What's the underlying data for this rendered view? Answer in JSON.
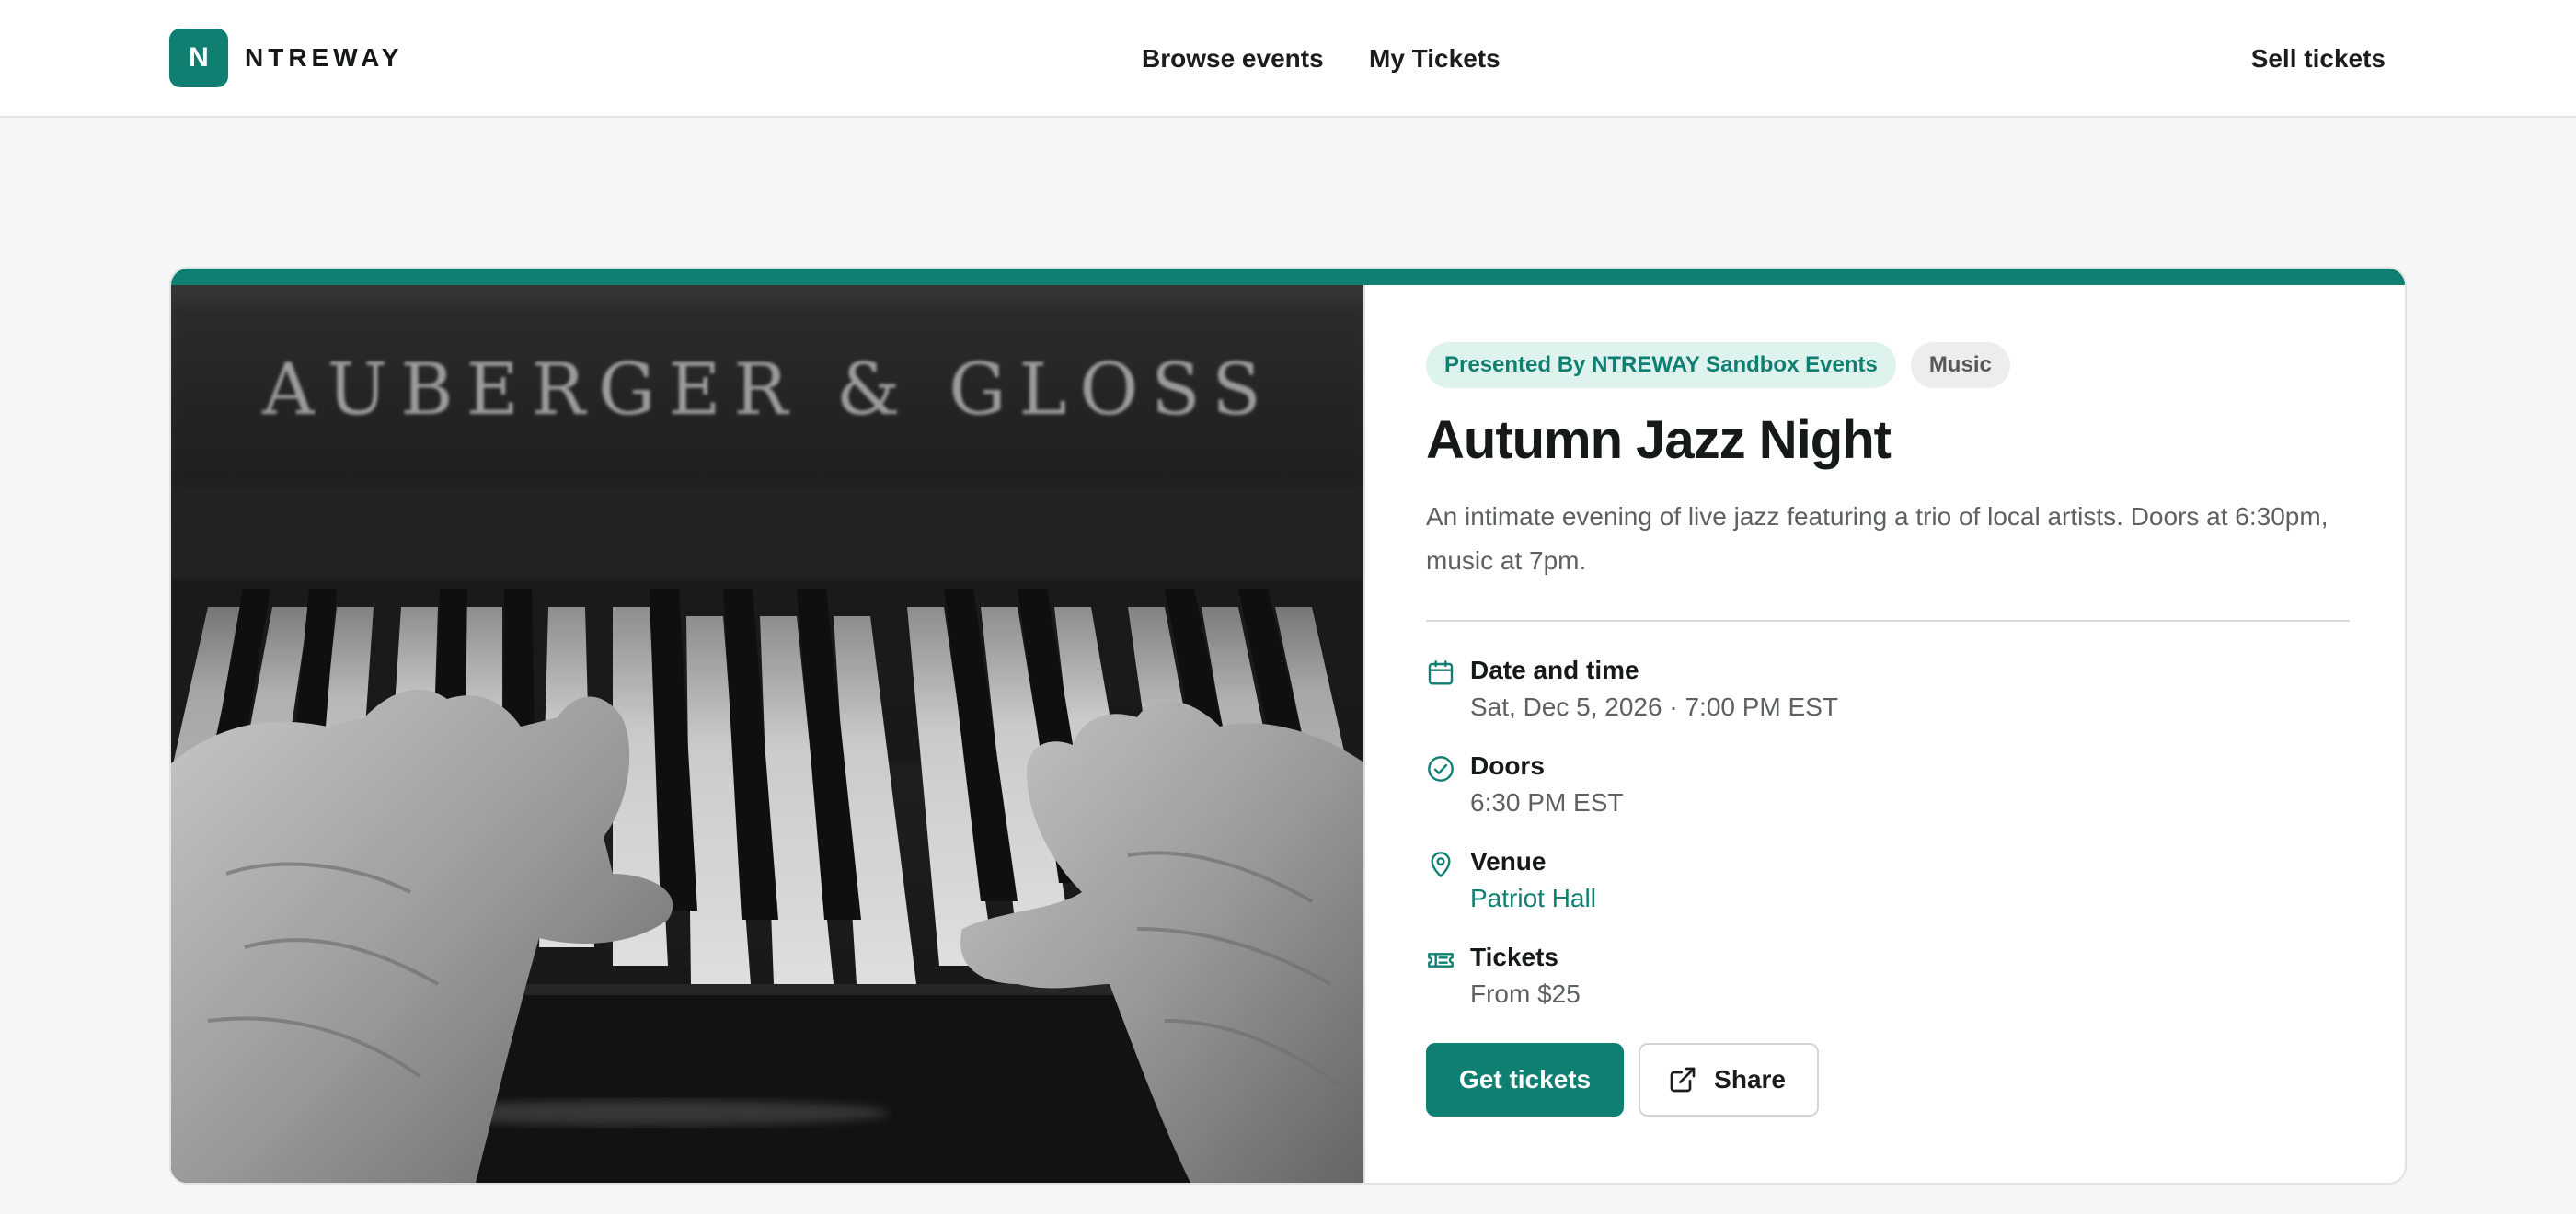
{
  "header": {
    "logo_letter": "N",
    "logo_text": "NTREWAY",
    "nav": {
      "browse": "Browse events",
      "my_tickets": "My Tickets"
    },
    "sell": "Sell tickets"
  },
  "event": {
    "presenter_tag": "Presented By NTREWAY Sandbox Events",
    "category_tag": "Music",
    "title": "Autumn Jazz Night",
    "description": "An intimate evening of live jazz featuring a trio of local artists. Doors at 6:30pm, music at 7pm.",
    "image_text": "AUBERGER & GLOSS",
    "info": {
      "date": {
        "label": "Date and time",
        "value": "Sat, Dec 5, 2026 · 7:00 PM EST",
        "icon": "calendar-icon"
      },
      "doors": {
        "label": "Doors",
        "value": "6:30 PM EST",
        "icon": "check-circle-icon"
      },
      "venue": {
        "label": "Venue",
        "value": "Patriot Hall",
        "icon": "map-pin-icon"
      },
      "tickets": {
        "label": "Tickets",
        "value": "From $25",
        "icon": "ticket-icon"
      }
    },
    "actions": {
      "get_tickets": "Get tickets",
      "share": "Share"
    }
  },
  "colors": {
    "accent": "#0f7f71",
    "accent_light": "#def2ee",
    "page_bg": "#f5f6f7"
  }
}
